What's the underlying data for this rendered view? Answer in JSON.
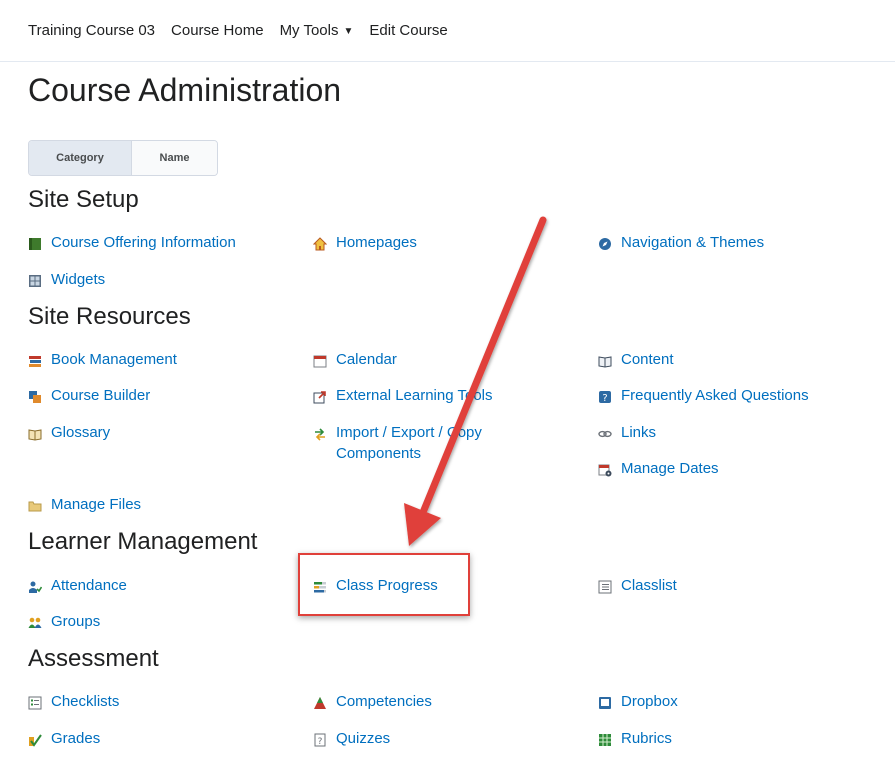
{
  "nav": {
    "course": "Training Course 03",
    "home": "Course Home",
    "tools": "My Tools",
    "edit": "Edit Course"
  },
  "title": "Course Administration",
  "view_toggle": {
    "category": "Category",
    "name": "Name"
  },
  "sections": {
    "site_setup": {
      "title": "Site Setup",
      "tools": {
        "course_offering_information": {
          "label": "Course Offering Information",
          "icon": "book-icon"
        },
        "homepages": {
          "label": "Homepages",
          "icon": "home-icon"
        },
        "navigation_themes": {
          "label": "Navigation & Themes",
          "icon": "compass-icon"
        },
        "widgets": {
          "label": "Widgets",
          "icon": "widgets-icon"
        }
      }
    },
    "site_resources": {
      "title": "Site Resources",
      "tools": {
        "book_management": {
          "label": "Book Management",
          "icon": "books-icon"
        },
        "calendar": {
          "label": "Calendar",
          "icon": "calendar-icon"
        },
        "content": {
          "label": "Content",
          "icon": "open-book-icon"
        },
        "course_builder": {
          "label": "Course Builder",
          "icon": "builder-icon"
        },
        "external_learning_tools": {
          "label": "External Learning Tools",
          "icon": "external-icon"
        },
        "faq": {
          "label": "Frequently Asked Questions",
          "icon": "faq-icon"
        },
        "glossary": {
          "label": "Glossary",
          "icon": "glossary-icon"
        },
        "import_export_copy": {
          "label": "Import / Export / Copy Components",
          "icon": "import-export-icon"
        },
        "links": {
          "label": "Links",
          "icon": "link-icon"
        },
        "manage_dates": {
          "label": "Manage Dates",
          "icon": "dates-icon"
        },
        "manage_files": {
          "label": "Manage Files",
          "icon": "folder-icon"
        }
      }
    },
    "learner_management": {
      "title": "Learner Management",
      "tools": {
        "attendance": {
          "label": "Attendance",
          "icon": "attendance-icon"
        },
        "class_progress": {
          "label": "Class Progress",
          "icon": "progress-icon"
        },
        "classlist": {
          "label": "Classlist",
          "icon": "list-icon"
        },
        "groups": {
          "label": "Groups",
          "icon": "groups-icon"
        }
      }
    },
    "assessment": {
      "title": "Assessment",
      "tools": {
        "checklists": {
          "label": "Checklists",
          "icon": "checklist-icon"
        },
        "competencies": {
          "label": "Competencies",
          "icon": "triangle-icon"
        },
        "dropbox": {
          "label": "Dropbox",
          "icon": "dropbox-icon"
        },
        "grades": {
          "label": "Grades",
          "icon": "grades-icon"
        },
        "quizzes": {
          "label": "Quizzes",
          "icon": "quiz-icon"
        },
        "rubrics": {
          "label": "Rubrics",
          "icon": "rubrics-icon"
        }
      }
    }
  },
  "colors": {
    "link": "#006fbf",
    "annotation": "#e0403a"
  }
}
